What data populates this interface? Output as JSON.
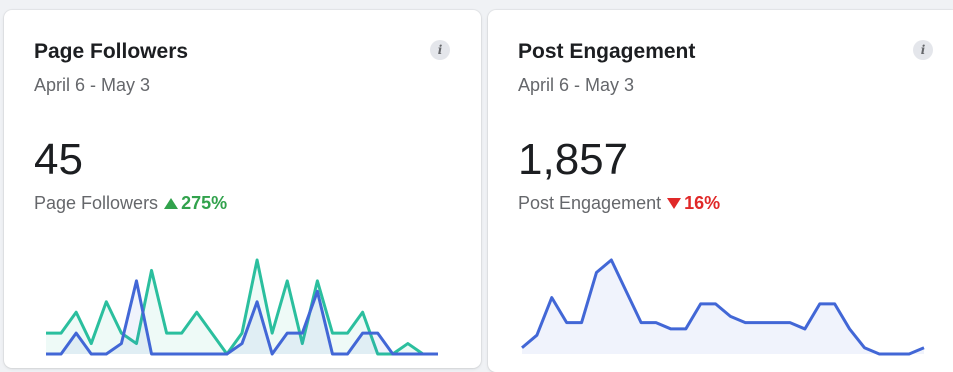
{
  "cards": [
    {
      "title": "Page Followers",
      "date_range": "April 6 - May 3",
      "value": "45",
      "metric_label": "Page Followers",
      "change": "275%",
      "change_direction": "up",
      "info_icon": "i"
    },
    {
      "title": "Post Engagement",
      "date_range": "April 6 - May 3",
      "value": "1,857",
      "metric_label": "Post Engagement",
      "change": "16%",
      "change_direction": "down",
      "info_icon": "i"
    }
  ],
  "colors": {
    "up": "#31a24c",
    "down": "#e02828",
    "series_primary": "#4267d6",
    "series_secondary": "#2bbf9e"
  },
  "chart_data": [
    {
      "type": "line",
      "series": [
        {
          "values": [
            2,
            2,
            4,
            1,
            5,
            2,
            1,
            8,
            2,
            2,
            4,
            2,
            0,
            2,
            9,
            2,
            7,
            1,
            7,
            2,
            2,
            4,
            0,
            0,
            1,
            0,
            0
          ]
        },
        {
          "values": [
            0,
            0,
            2,
            0,
            0,
            1,
            7,
            0,
            0,
            0,
            0,
            0,
            0,
            1,
            5,
            0,
            2,
            2,
            6,
            0,
            0,
            2,
            2,
            0,
            0,
            0,
            0
          ]
        }
      ]
    },
    {
      "type": "area",
      "series": [
        {
          "values": [
            1,
            3,
            9,
            5,
            5,
            13,
            15,
            10,
            5,
            5,
            4,
            4,
            8,
            8,
            6,
            5,
            5,
            5,
            5,
            4,
            8,
            8,
            4,
            1,
            0,
            0,
            0,
            1
          ]
        }
      ]
    }
  ]
}
